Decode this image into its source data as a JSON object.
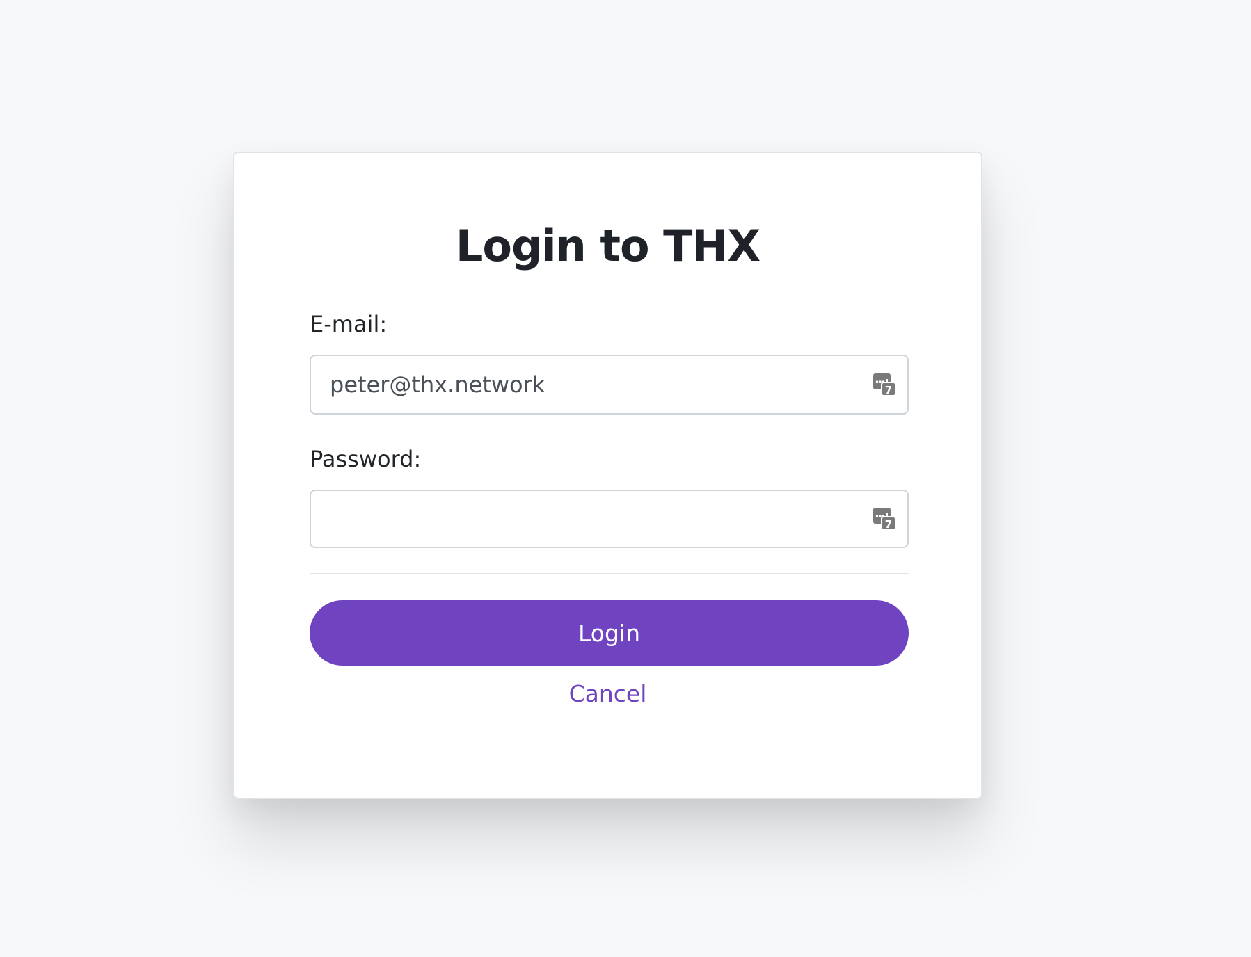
{
  "dialog": {
    "title": "Login to THX",
    "email": {
      "label": "E-mail:",
      "value": "peter@thx.network",
      "placeholder": ""
    },
    "password": {
      "label": "Password:",
      "value": "",
      "placeholder": ""
    },
    "field_icon": "password-manager-icon",
    "field_icon_badge": "7",
    "login_label": "Login",
    "cancel_label": "Cancel"
  },
  "colors": {
    "accent": "#7043c0",
    "background": "#f7f8fa",
    "card": "#ffffff",
    "text": "#212529",
    "icon": "#7a7a7a"
  }
}
